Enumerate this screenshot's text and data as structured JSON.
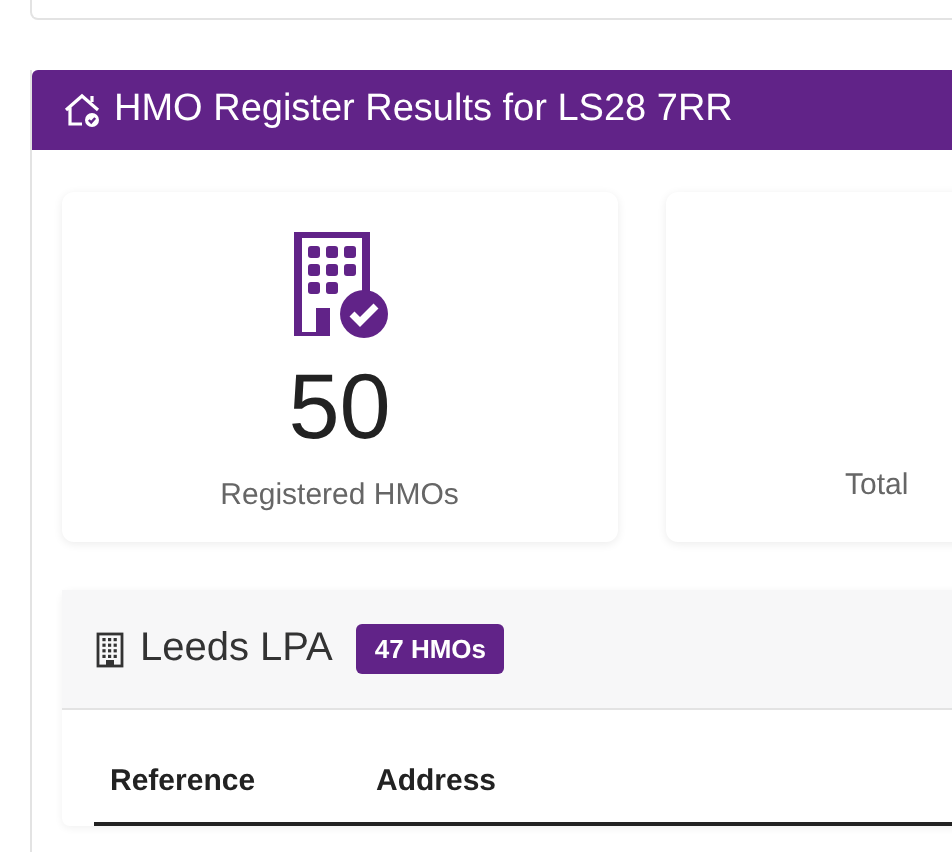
{
  "header": {
    "title": "HMO Register Results for LS28 7RR"
  },
  "stats": [
    {
      "value": "50",
      "label": "Registered HMOs"
    },
    {
      "label": "Total"
    }
  ],
  "authority": {
    "name": "Leeds LPA",
    "badge": "47 HMOs"
  },
  "table": {
    "columns": [
      "Reference",
      "Address"
    ]
  }
}
